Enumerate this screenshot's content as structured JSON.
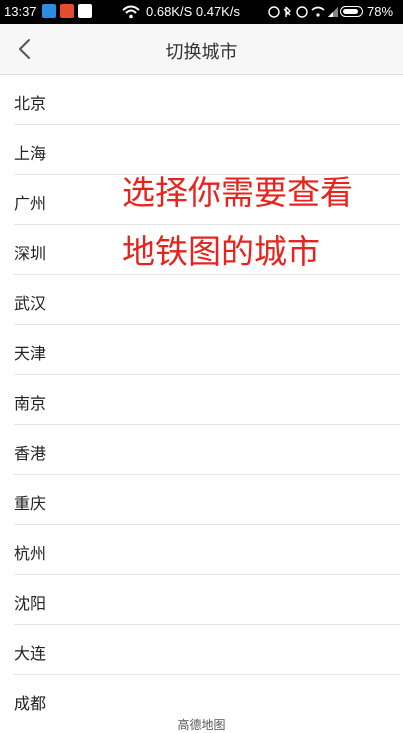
{
  "status_bar": {
    "time": "13:37",
    "network": "0.68K/S 0.47K/s",
    "battery": "78%"
  },
  "header": {
    "title": "切换城市"
  },
  "cities": [
    "北京",
    "上海",
    "广州",
    "深圳",
    "武汉",
    "天津",
    "南京",
    "香港",
    "重庆",
    "杭州",
    "沈阳",
    "大连",
    "成都"
  ],
  "annotation": {
    "line1": "选择你需要查看",
    "line2": "地铁图的城市"
  },
  "watermark": "高德地图"
}
